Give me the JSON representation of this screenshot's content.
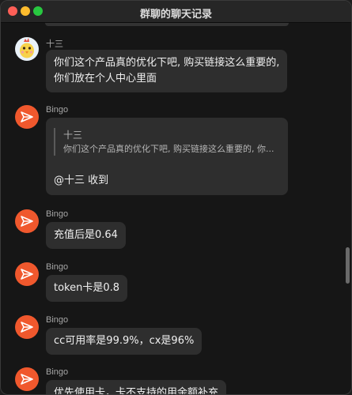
{
  "window": {
    "title": "群聊的聊天记录"
  },
  "messages": [
    {
      "sender": "十三",
      "avatar_icon": "chick-icon",
      "lines": [
        "你们这个产品真的优化下吧, 购买链接这么重要的,",
        "你们放在个人中心里面"
      ]
    },
    {
      "sender": "Bingo",
      "avatar_icon": "paper-plane-icon",
      "quote": {
        "name": "十三",
        "text": "你们这个产品真的优化下吧, 购买链接这么重要的, 你..."
      },
      "text": "@十三 收到"
    },
    {
      "sender": "Bingo",
      "avatar_icon": "paper-plane-icon",
      "text": "充值后是0.64"
    },
    {
      "sender": "Bingo",
      "avatar_icon": "paper-plane-icon",
      "text": "token卡是0.8"
    },
    {
      "sender": "Bingo",
      "avatar_icon": "paper-plane-icon",
      "text": "cc可用率是99.9%，cx是96%"
    },
    {
      "sender": "Bingo",
      "avatar_icon": "paper-plane-icon",
      "text": "优先使用卡，卡不支持的用余额补充"
    }
  ],
  "colors": {
    "background": "#161616",
    "bubble": "#2e2e2e",
    "avatar_orange": "#f0582d"
  }
}
